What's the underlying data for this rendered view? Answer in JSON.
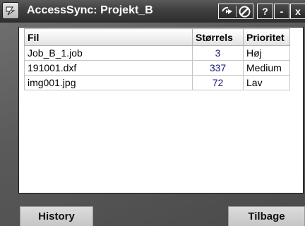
{
  "window": {
    "title": "AccessSync: Projekt_B"
  },
  "toolbar": {
    "help_label": "?",
    "minimize_label": "-",
    "close_label": "x"
  },
  "table": {
    "headers": {
      "name": "Fil",
      "size": "Størrels",
      "priority": "Prioritet"
    },
    "rows": [
      {
        "name": "Job_B_1.job",
        "size": "3",
        "priority": "Høj"
      },
      {
        "name": "191001.dxf",
        "size": "337",
        "priority": "Medium"
      },
      {
        "name": "img001.jpg",
        "size": "72",
        "priority": "Lav"
      }
    ]
  },
  "buttons": {
    "history_label": "History",
    "back_label": "Tilbage"
  },
  "colors": {
    "titlebar": "#3f3f3f",
    "frame": "#5a5a5a",
    "panel": "#ffffff",
    "button": "#d0d0d0"
  }
}
